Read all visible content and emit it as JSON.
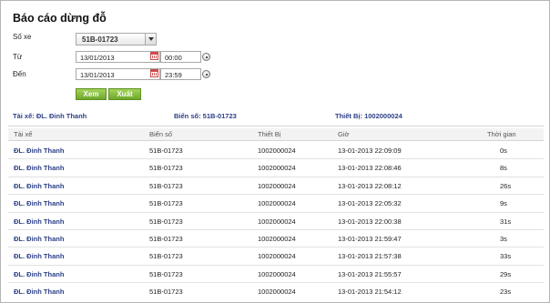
{
  "page": {
    "title": "Báo cáo dừng đỗ"
  },
  "filters": {
    "plate_label": "Số xe",
    "plate_value": "51B-01723",
    "from_label": "Từ",
    "from_date": "13/01/2013",
    "from_time": "00:00",
    "to_label": "Đến",
    "to_date": "13/01/2013",
    "to_time": "23:59"
  },
  "actions": {
    "view_label": "Xem",
    "export_label": "Xuất"
  },
  "summary": {
    "driver": "Tài xế: ĐL. Đinh Thanh",
    "plate": "Biển số: 51B-01723",
    "device": "Thiết Bị: 1002000024"
  },
  "table": {
    "headers": [
      "Tài xế",
      "Biển số",
      "Thiết Bị",
      "Giờ",
      "Thời gian"
    ],
    "rows": [
      [
        "ĐL. Đinh Thanh",
        "51B-01723",
        "1002000024",
        "13-01-2013 22:09:09",
        "0s"
      ],
      [
        "ĐL. Đinh Thanh",
        "51B-01723",
        "1002000024",
        "13-01-2013 22:08:46",
        "8s"
      ],
      [
        "ĐL. Đinh Thanh",
        "51B-01723",
        "1002000024",
        "13-01-2013 22:08:12",
        "26s"
      ],
      [
        "ĐL. Đinh Thanh",
        "51B-01723",
        "1002000024",
        "13-01-2013 22:05:32",
        "9s"
      ],
      [
        "ĐL. Đinh Thanh",
        "51B-01723",
        "1002000024",
        "13-01-2013 22:00:38",
        "31s"
      ],
      [
        "ĐL. Đinh Thanh",
        "51B-01723",
        "1002000024",
        "13-01-2013 21:59:47",
        "3s"
      ],
      [
        "ĐL. Đinh Thanh",
        "51B-01723",
        "1002000024",
        "13-01-2013 21:57:38",
        "33s"
      ],
      [
        "ĐL. Đinh Thanh",
        "51B-01723",
        "1002000024",
        "13-01-2013 21:55:57",
        "29s"
      ],
      [
        "ĐL. Đinh Thanh",
        "51B-01723",
        "1002000024",
        "13-01-2013 21:54:12",
        "23s"
      ]
    ]
  },
  "colors": {
    "accent_green": "#7cb83a",
    "link_blue": "#2b3f87"
  },
  "icons": {
    "calendar": "calendar-icon",
    "clock": "clock-icon",
    "dropdown": "chevron-down-icon"
  }
}
